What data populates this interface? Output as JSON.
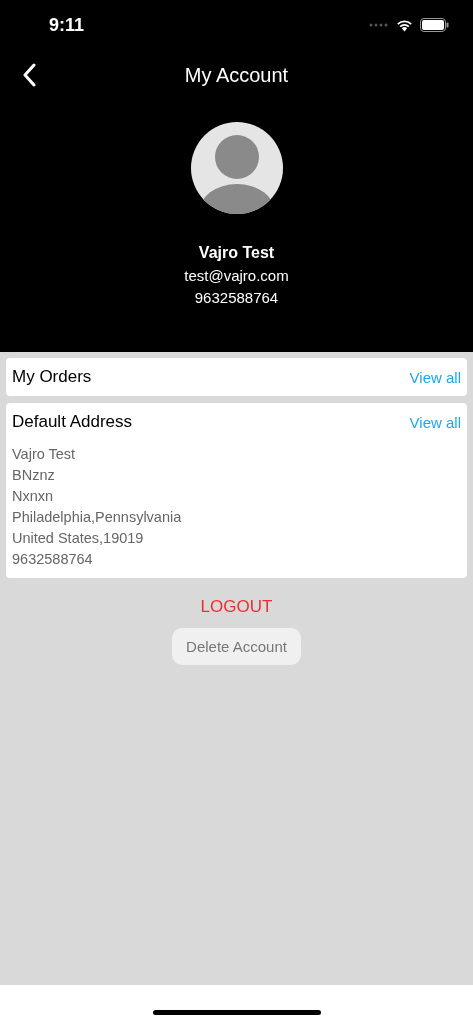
{
  "status_bar": {
    "time": "9:11"
  },
  "nav": {
    "title": "My Account"
  },
  "profile": {
    "name": "Vajro Test",
    "email": "test@vajro.com",
    "phone": "9632588764"
  },
  "sections": [
    {
      "title": "My Orders",
      "link": "View all"
    },
    {
      "title": "Default Address",
      "link": "View all",
      "lines": [
        "Vajro Test",
        "BNznz",
        "Nxnxn",
        "Philadelphia,Pennsylvania",
        "United States,19019",
        "9632588764"
      ]
    }
  ],
  "logout": "LOGOUT",
  "delete_button": "Delete Account"
}
